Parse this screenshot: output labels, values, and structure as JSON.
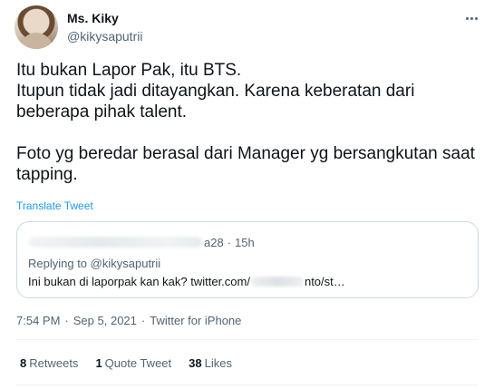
{
  "author": {
    "display_name": "Ms. Kiky",
    "handle": "@kikysaputrii"
  },
  "tweet": {
    "text": "Itu bukan Lapor Pak, itu BTS.\nItupun tidak jadi ditayangkan. Karena keberatan dari beberapa pihak talent.\n\nFoto yg beredar berasal dari Manager yg bersangkutan saat tapping.",
    "translate_label": "Translate Tweet"
  },
  "quoted_tweet": {
    "handle_tail": "a28",
    "separator": "·",
    "time": "15h",
    "replying_prefix": "Replying to",
    "replying_to": "@kikysaputrii",
    "body_start": "Ini bukan di laporpak kan kak? twitter.com/",
    "body_end": "nto/st…"
  },
  "meta": {
    "time": "7:54 PM",
    "separator": "·",
    "date": "Sep 5, 2021",
    "source": "Twitter for iPhone"
  },
  "stats": {
    "retweets_count": "8",
    "retweets_label": "Retweets",
    "quotes_count": "1",
    "quotes_label": "Quote Tweet",
    "likes_count": "38",
    "likes_label": "Likes"
  }
}
